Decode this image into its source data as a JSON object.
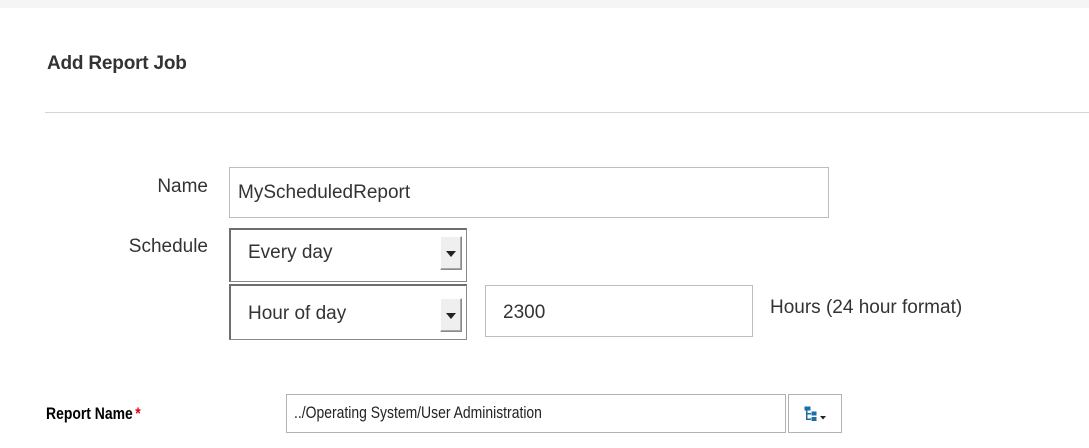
{
  "dialog": {
    "title": "Add Report Job"
  },
  "form": {
    "name_label": "Name",
    "name_value": "MyScheduledReport",
    "schedule_label": "Schedule",
    "schedule_frequency": "Every day",
    "schedule_unit": "Hour of day",
    "schedule_value": "2300",
    "schedule_unit_note": "Hours (24 hour format)",
    "report_name_label": "Report Name",
    "report_name_required": "*",
    "report_name_value": "../Operating System/User Administration"
  },
  "icons": {
    "dropdown": "chevron-down-icon",
    "tree_picker": "tree-browse-icon"
  },
  "colors": {
    "required_marker": "#e0001b",
    "tree_icon": "#1a6fa8"
  }
}
